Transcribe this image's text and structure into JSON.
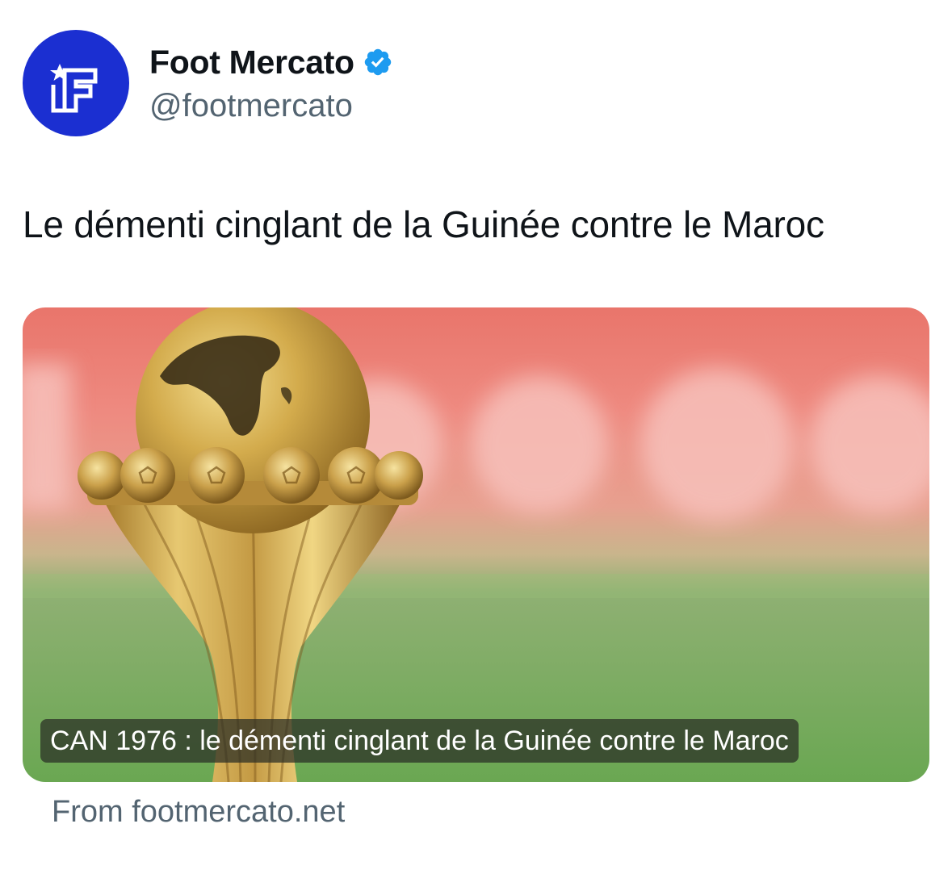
{
  "author": {
    "display_name": "Foot Mercato",
    "handle": "@footmercato",
    "verified": true,
    "avatar_icon": "foot-mercato-logo",
    "avatar_color": "#1b2fd1"
  },
  "tweet": {
    "text": "Le démenti cinglant de la Guinée contre le Maroc"
  },
  "link_card": {
    "image_description_icon": "trophy-image",
    "caption": "CAN 1976 : le démenti cinglant de la Guinée contre le Maroc",
    "source": "From footmercato.net"
  },
  "colors": {
    "verified_badge": "#1d9bf0",
    "secondary_text": "#536471",
    "primary_text": "#0f1419"
  }
}
